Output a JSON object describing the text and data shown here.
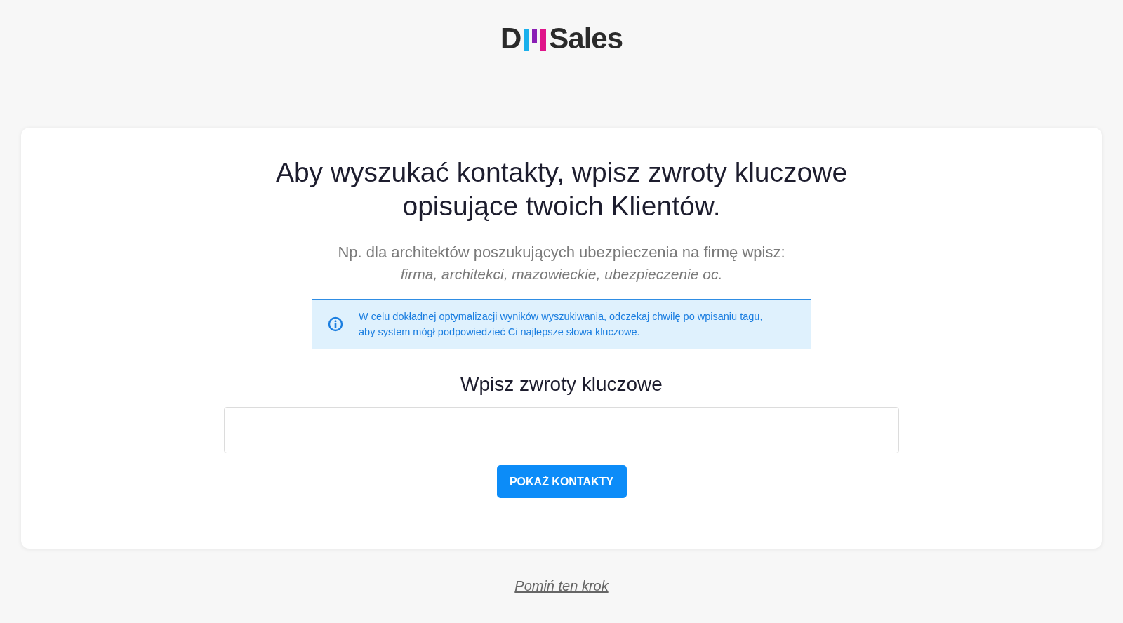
{
  "logo": {
    "prefix": "D",
    "suffix": "Sales"
  },
  "heading": [
    "Aby wyszukać kontakty, wpisz zwroty kluczowe",
    "opisujące twoich Klientów."
  ],
  "example": {
    "intro": "Np. dla architektów poszukujących ubezpieczenia na firmę wpisz:",
    "keywords": "firma, architekci, mazowieckie, ubezpieczenie oc."
  },
  "info": {
    "lines": [
      "W celu dokładnej optymalizacji wyników wyszukiwania, odczekaj chwilę po wpisaniu tagu,",
      "aby system mógł podpowiedzieć Ci najlepsze słowa kluczowe."
    ]
  },
  "field_label": "Wpisz zwroty kluczowe",
  "button": "POKAŻ KONTAKTY",
  "skip_link": "Pomiń ten krok"
}
